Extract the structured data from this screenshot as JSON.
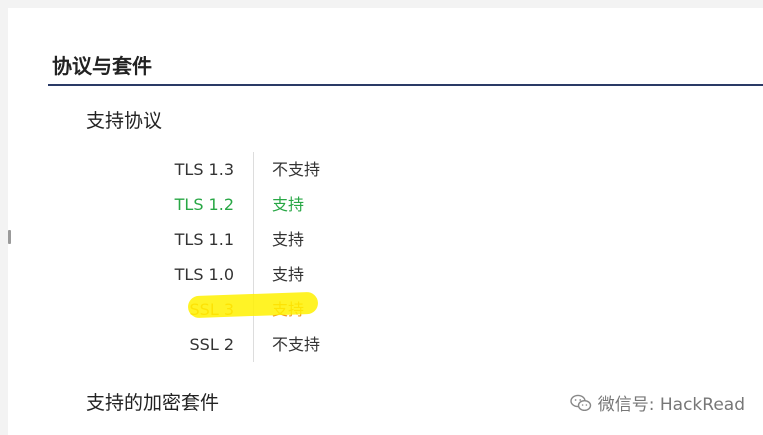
{
  "section": {
    "title": "协议与套件"
  },
  "protocols": {
    "heading": "支持协议",
    "rows": [
      {
        "name": "TLS 1.3",
        "status": "不支持",
        "color": "#333333"
      },
      {
        "name": "TLS 1.2",
        "status": "支持",
        "color": "#28a745"
      },
      {
        "name": "TLS 1.1",
        "status": "支持",
        "color": "#333333"
      },
      {
        "name": "TLS 1.0",
        "status": "支持",
        "color": "#333333"
      },
      {
        "name": "SSL 3",
        "status": "支持",
        "color": "#f0951c",
        "highlighted": true
      },
      {
        "name": "SSL 2",
        "status": "不支持",
        "color": "#333333"
      }
    ]
  },
  "ciphers": {
    "heading": "支持的加密套件"
  },
  "watermark": {
    "icon": "wechat-icon",
    "text": "微信号: HackRead"
  },
  "colors": {
    "accent_rule": "#2a3a66",
    "supported_green": "#28a745",
    "warning_orange": "#f0951c",
    "highlight_yellow": "#fff100"
  }
}
